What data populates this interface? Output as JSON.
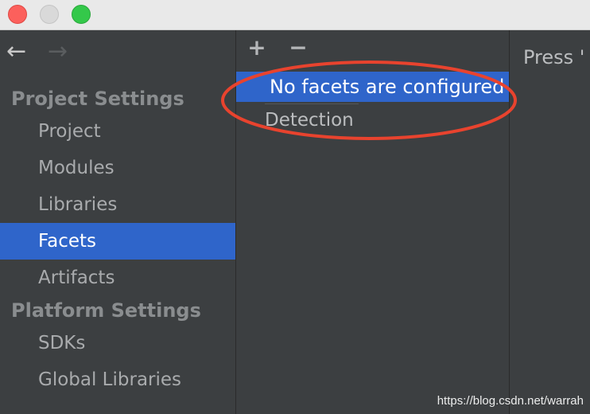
{
  "window": {
    "controls": [
      "close",
      "minimize",
      "maximize"
    ]
  },
  "navigation": {
    "back_icon": "←",
    "forward_icon": "→"
  },
  "sidebar": {
    "project_settings_header": "Project Settings",
    "project_items": [
      {
        "label": "Project",
        "selected": false
      },
      {
        "label": "Modules",
        "selected": false
      },
      {
        "label": "Libraries",
        "selected": false
      },
      {
        "label": "Facets",
        "selected": true
      },
      {
        "label": "Artifacts",
        "selected": false
      }
    ],
    "platform_settings_header": "Platform Settings",
    "platform_items": [
      {
        "label": "SDKs",
        "selected": false
      },
      {
        "label": "Global Libraries",
        "selected": false
      }
    ]
  },
  "facets_panel": {
    "add_icon": "+",
    "remove_icon": "−",
    "empty_message": "No facets are configured",
    "detection_label": "Detection"
  },
  "details_panel": {
    "text": "Press '"
  },
  "watermark": "https://blog.csdn.net/warrah",
  "colors": {
    "background": "#3c3f41",
    "selection": "#2f65ca",
    "annotation": "#e8432e",
    "close": "#fc605c",
    "maximize": "#34c84a"
  }
}
